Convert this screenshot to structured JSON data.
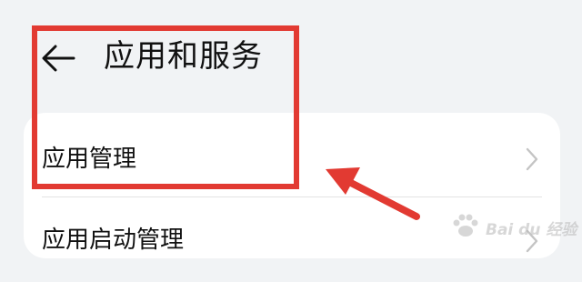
{
  "header": {
    "title": "应用和服务",
    "back_icon": "arrow-left-icon"
  },
  "list": {
    "items": [
      {
        "label": "应用管理",
        "icon": "chevron-right-icon"
      },
      {
        "label": "应用启动管理",
        "icon": "chevron-right-icon"
      }
    ]
  },
  "annotation": {
    "color": "#e23a32"
  },
  "watermark": {
    "text": "Bai du 经验"
  },
  "colors": {
    "background": "#f1f3f5",
    "card": "#ffffff",
    "chevron": "#c4c4c4"
  }
}
